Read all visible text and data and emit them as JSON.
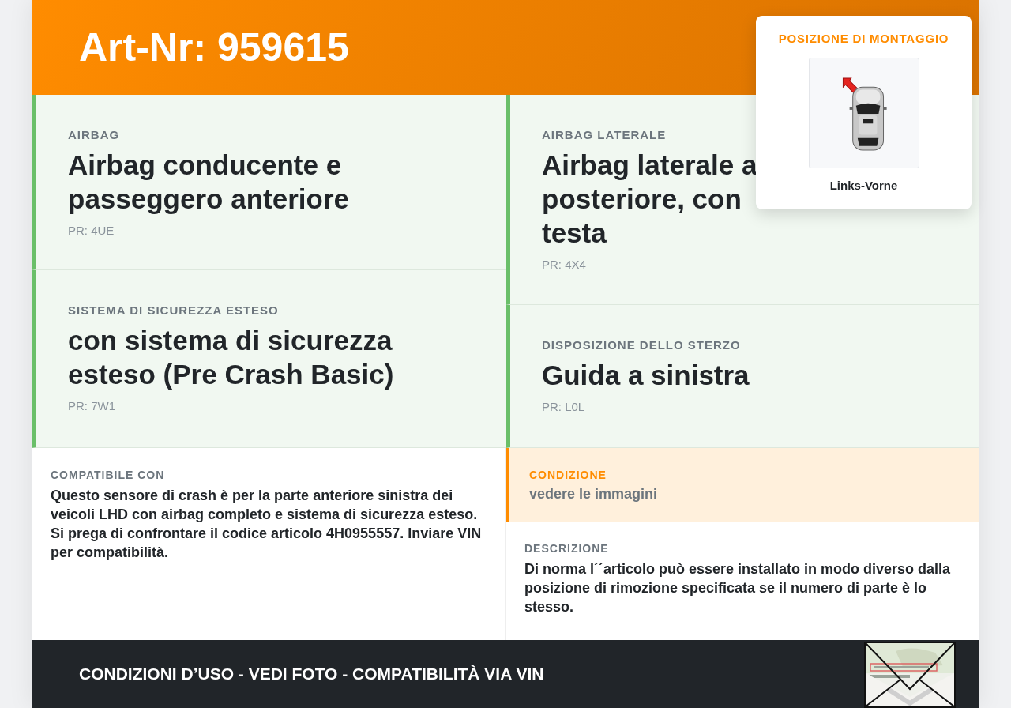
{
  "header": {
    "title": "Art-Nr: 959615"
  },
  "mount_position": {
    "heading": "POSIZIONE DI MONTAGGIO",
    "caption": "Links-Vorne"
  },
  "spec_columns": [
    [
      {
        "label": "AIRBAG",
        "title_parts": [
          "Airbag conducente e passeggero anteriore"
        ],
        "code": "PR: 4UE"
      },
      {
        "label": "SISTEMA DI SICUREZZA ESTESO",
        "title_parts": [
          "con sistema di sicurezza esteso (Pre Crash Basic)"
        ],
        "code": "PR: 7W1"
      }
    ],
    [
      {
        "label": "AIRBAG LATERALE",
        "title_parts": [
          "Airbag laterale a",
          "posteriore, con",
          "testa"
        ],
        "code": "PR: 4X4"
      },
      {
        "label": "DISPOSIZIONE DELLO STERZO",
        "title_parts": [
          "Guida a sinistra"
        ],
        "code": "PR: L0L"
      }
    ]
  ],
  "compatibility": {
    "label": "COMPATIBILE CON",
    "text": "Questo sensore di crash è per la parte anteriore sinistra dei veicoli LHD con airbag completo e sistema di sicurezza esteso. Si prega di confrontare il codice articolo 4H0955557. Inviare VIN per compatibilità."
  },
  "condition": {
    "label": "CONDIZIONE",
    "value": "vedere le immagini"
  },
  "description": {
    "label": "DESCRIZIONE",
    "text": "Di norma l´´articolo può essere installato in modo diverso dalla posizione di rimozione specificata se il numero di parte è lo stesso."
  },
  "footer": {
    "text": "CONDIZIONI D’USO - VEDI FOTO - COMPATIBILITÀ VIA VIN"
  }
}
